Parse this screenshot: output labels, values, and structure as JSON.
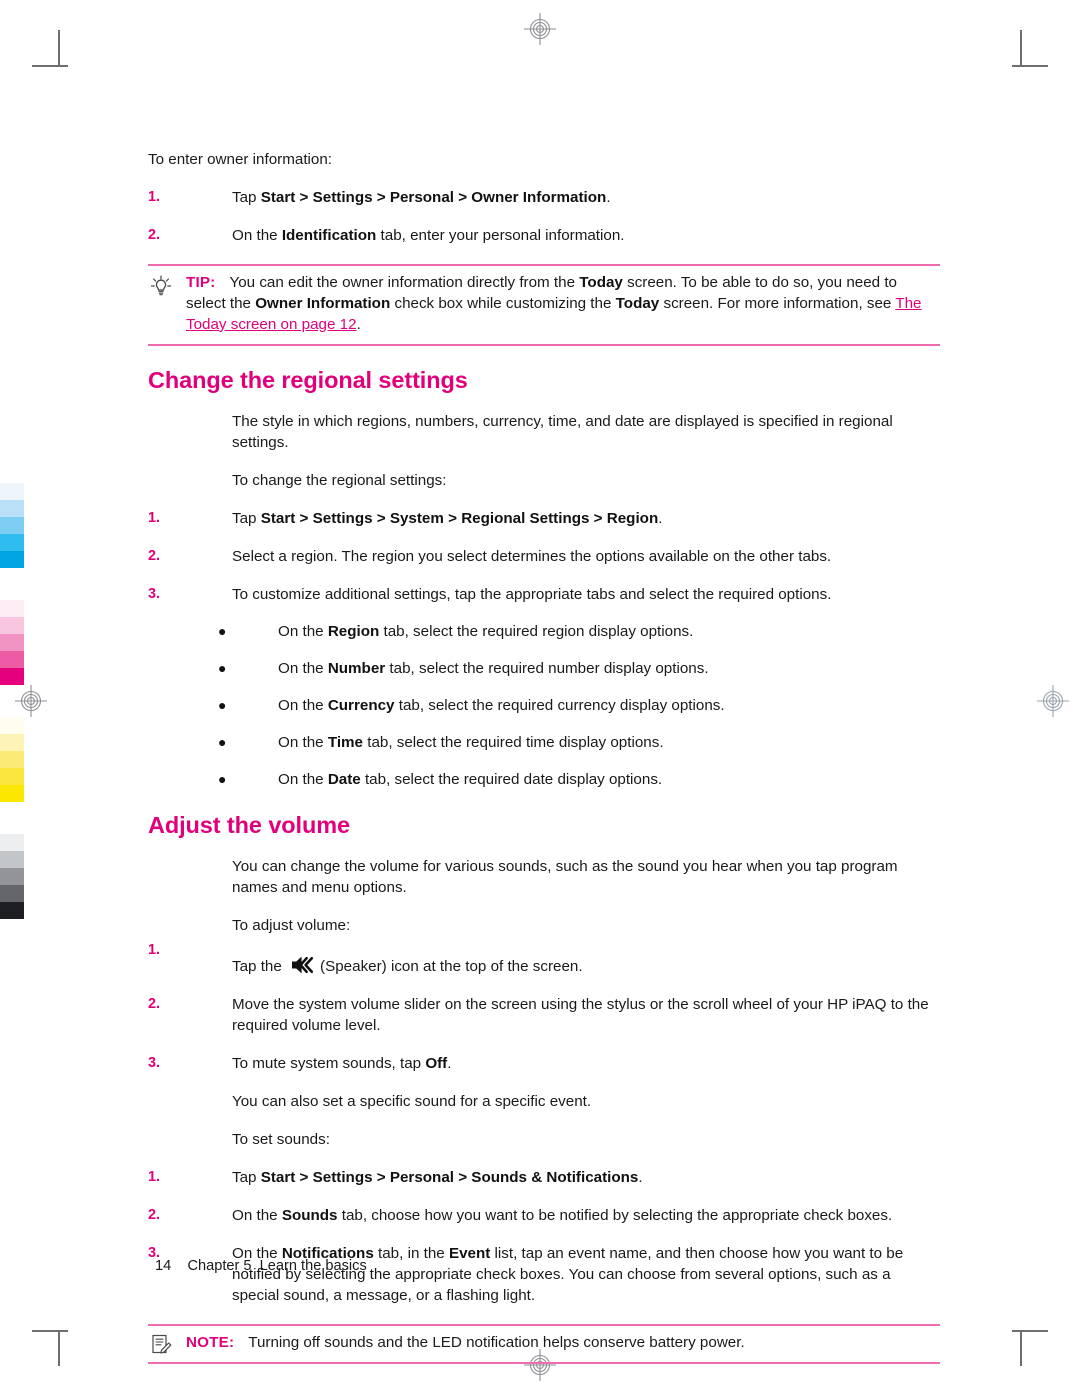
{
  "document": {
    "footer": {
      "page_number": "14",
      "chapter": "Chapter 5",
      "chapter_title": "Learn the basics"
    }
  },
  "intro": {
    "lead": "To enter owner information:",
    "steps": [
      {
        "num": "1.",
        "prefix": "Tap ",
        "bold": "Start > Settings > Personal > Owner Information",
        "suffix": "."
      },
      {
        "num": "2.",
        "prefix": "On the ",
        "bold": "Identification",
        "suffix": " tab, enter your personal information."
      }
    ]
  },
  "tip": {
    "icon": "lightbulb-icon",
    "label": "TIP:",
    "part1": "You can edit the owner information directly from the ",
    "bold1": "Today",
    "part2": " screen. To be able to do so, you need to select the ",
    "bold2": "Owner Information",
    "part3": " check box while customizing the ",
    "bold3": "Today",
    "part4": " screen. For more information, see ",
    "link": "The Today screen on page 12",
    "part5": "."
  },
  "regional": {
    "heading": "Change the regional settings",
    "para1": "The style in which regions, numbers, currency, time, and date are displayed is specified in regional settings.",
    "para2": "To change the regional settings:",
    "steps": [
      {
        "num": "1.",
        "prefix": "Tap ",
        "bold": "Start > Settings > System > Regional Settings > Region",
        "suffix": "."
      },
      {
        "num": "2.",
        "prefix": "Select a region. The region you select determines the options available on the other tabs.",
        "bold": "",
        "suffix": ""
      },
      {
        "num": "3.",
        "prefix": "To customize additional settings, tap the appropriate tabs and select the required options.",
        "bold": "",
        "suffix": ""
      }
    ],
    "bullets": [
      {
        "dot": "●",
        "prefix": "On the ",
        "bold": "Region",
        "suffix": " tab, select the required region display options."
      },
      {
        "dot": "●",
        "prefix": "On the ",
        "bold": "Number",
        "suffix": " tab, select the required number display options."
      },
      {
        "dot": "●",
        "prefix": "On the ",
        "bold": "Currency",
        "suffix": " tab, select the required currency display options."
      },
      {
        "dot": "●",
        "prefix": "On the ",
        "bold": "Time",
        "suffix": " tab, select the required time display options."
      },
      {
        "dot": "●",
        "prefix": "On the ",
        "bold": "Date",
        "suffix": " tab, select the required date display options."
      }
    ]
  },
  "volume": {
    "heading": "Adjust the volume",
    "para1": "You can change the volume for various sounds, such as the sound you hear when you tap program names and menu options.",
    "para2": "To adjust volume:",
    "step1": {
      "num": "1.",
      "prefix": "Tap the ",
      "icon": "speaker-icon",
      "suffix": "(Speaker) icon at the top of the screen."
    },
    "steps": [
      {
        "num": "2.",
        "prefix": "Move the system volume slider on the screen using the stylus or the scroll wheel of your HP iPAQ to the required volume level.",
        "bold": "",
        "suffix": ""
      },
      {
        "num": "3.",
        "prefix": "To mute system sounds, tap ",
        "bold": "Off",
        "suffix": "."
      }
    ],
    "para3": "You can also set a specific sound for a specific event.",
    "para4": "To set sounds:",
    "sound_steps": [
      {
        "num": "1.",
        "prefix": "Tap ",
        "bold": "Start > Settings > Personal > Sounds & Notifications",
        "suffix": "."
      },
      {
        "num": "2.",
        "prefix": "On the ",
        "bold": "Sounds",
        "suffix": " tab, choose how you want to be notified by selecting the appropriate check boxes."
      }
    ],
    "step3": {
      "num": "3.",
      "prefix": "On the ",
      "bold1": "Notifications",
      "mid1": " tab, in the ",
      "bold2": "Event",
      "suffix": " list, tap an event name, and then choose how you want to be notified by selecting the appropriate check boxes. You can choose from several options, such as a special sound, a message, or a flashing light."
    }
  },
  "note": {
    "icon": "note-pad-icon",
    "label": "NOTE:",
    "text": "Turning off sounds and the LED notification helps conserve battery power."
  },
  "colors": {
    "accent_magenta": "#e2007a",
    "rule_pink": "#f06ab0",
    "body_text": "#1a1a1a",
    "crop_mark": "#6e6e6e"
  },
  "calibration": {
    "cyan": [
      "#eef6fc",
      "#b9e0f6",
      "#7ccdf1",
      "#2ebdee",
      "#00a5e4"
    ],
    "magenta": [
      "#fdeef5",
      "#f8c6de",
      "#f294c3",
      "#ec5ba4",
      "#e5007e"
    ],
    "yellow": [
      "#fffdee",
      "#fdf3b6",
      "#fcea76",
      "#fbe53f",
      "#fbe700"
    ],
    "gray": [
      "#edeef0",
      "#c3c6c8",
      "#939499",
      "#65656c",
      "#1d1e22"
    ]
  }
}
